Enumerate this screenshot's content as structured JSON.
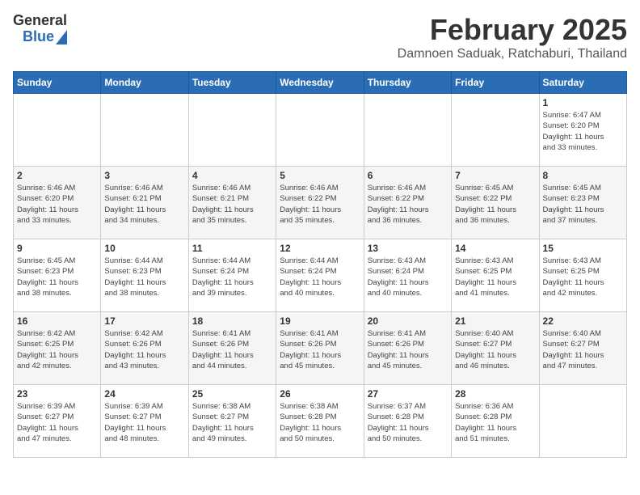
{
  "header": {
    "logo_general": "General",
    "logo_blue": "Blue",
    "month": "February 2025",
    "location": "Damnoen Saduak, Ratchaburi, Thailand"
  },
  "weekdays": [
    "Sunday",
    "Monday",
    "Tuesday",
    "Wednesday",
    "Thursday",
    "Friday",
    "Saturday"
  ],
  "weeks": [
    [
      {
        "day": "",
        "info": ""
      },
      {
        "day": "",
        "info": ""
      },
      {
        "day": "",
        "info": ""
      },
      {
        "day": "",
        "info": ""
      },
      {
        "day": "",
        "info": ""
      },
      {
        "day": "",
        "info": ""
      },
      {
        "day": "1",
        "info": "Sunrise: 6:47 AM\nSunset: 6:20 PM\nDaylight: 11 hours\nand 33 minutes."
      }
    ],
    [
      {
        "day": "2",
        "info": "Sunrise: 6:46 AM\nSunset: 6:20 PM\nDaylight: 11 hours\nand 33 minutes."
      },
      {
        "day": "3",
        "info": "Sunrise: 6:46 AM\nSunset: 6:21 PM\nDaylight: 11 hours\nand 34 minutes."
      },
      {
        "day": "4",
        "info": "Sunrise: 6:46 AM\nSunset: 6:21 PM\nDaylight: 11 hours\nand 35 minutes."
      },
      {
        "day": "5",
        "info": "Sunrise: 6:46 AM\nSunset: 6:22 PM\nDaylight: 11 hours\nand 35 minutes."
      },
      {
        "day": "6",
        "info": "Sunrise: 6:46 AM\nSunset: 6:22 PM\nDaylight: 11 hours\nand 36 minutes."
      },
      {
        "day": "7",
        "info": "Sunrise: 6:45 AM\nSunset: 6:22 PM\nDaylight: 11 hours\nand 36 minutes."
      },
      {
        "day": "8",
        "info": "Sunrise: 6:45 AM\nSunset: 6:23 PM\nDaylight: 11 hours\nand 37 minutes."
      }
    ],
    [
      {
        "day": "9",
        "info": "Sunrise: 6:45 AM\nSunset: 6:23 PM\nDaylight: 11 hours\nand 38 minutes."
      },
      {
        "day": "10",
        "info": "Sunrise: 6:44 AM\nSunset: 6:23 PM\nDaylight: 11 hours\nand 38 minutes."
      },
      {
        "day": "11",
        "info": "Sunrise: 6:44 AM\nSunset: 6:24 PM\nDaylight: 11 hours\nand 39 minutes."
      },
      {
        "day": "12",
        "info": "Sunrise: 6:44 AM\nSunset: 6:24 PM\nDaylight: 11 hours\nand 40 minutes."
      },
      {
        "day": "13",
        "info": "Sunrise: 6:43 AM\nSunset: 6:24 PM\nDaylight: 11 hours\nand 40 minutes."
      },
      {
        "day": "14",
        "info": "Sunrise: 6:43 AM\nSunset: 6:25 PM\nDaylight: 11 hours\nand 41 minutes."
      },
      {
        "day": "15",
        "info": "Sunrise: 6:43 AM\nSunset: 6:25 PM\nDaylight: 11 hours\nand 42 minutes."
      }
    ],
    [
      {
        "day": "16",
        "info": "Sunrise: 6:42 AM\nSunset: 6:25 PM\nDaylight: 11 hours\nand 42 minutes."
      },
      {
        "day": "17",
        "info": "Sunrise: 6:42 AM\nSunset: 6:26 PM\nDaylight: 11 hours\nand 43 minutes."
      },
      {
        "day": "18",
        "info": "Sunrise: 6:41 AM\nSunset: 6:26 PM\nDaylight: 11 hours\nand 44 minutes."
      },
      {
        "day": "19",
        "info": "Sunrise: 6:41 AM\nSunset: 6:26 PM\nDaylight: 11 hours\nand 45 minutes."
      },
      {
        "day": "20",
        "info": "Sunrise: 6:41 AM\nSunset: 6:26 PM\nDaylight: 11 hours\nand 45 minutes."
      },
      {
        "day": "21",
        "info": "Sunrise: 6:40 AM\nSunset: 6:27 PM\nDaylight: 11 hours\nand 46 minutes."
      },
      {
        "day": "22",
        "info": "Sunrise: 6:40 AM\nSunset: 6:27 PM\nDaylight: 11 hours\nand 47 minutes."
      }
    ],
    [
      {
        "day": "23",
        "info": "Sunrise: 6:39 AM\nSunset: 6:27 PM\nDaylight: 11 hours\nand 47 minutes."
      },
      {
        "day": "24",
        "info": "Sunrise: 6:39 AM\nSunset: 6:27 PM\nDaylight: 11 hours\nand 48 minutes."
      },
      {
        "day": "25",
        "info": "Sunrise: 6:38 AM\nSunset: 6:27 PM\nDaylight: 11 hours\nand 49 minutes."
      },
      {
        "day": "26",
        "info": "Sunrise: 6:38 AM\nSunset: 6:28 PM\nDaylight: 11 hours\nand 50 minutes."
      },
      {
        "day": "27",
        "info": "Sunrise: 6:37 AM\nSunset: 6:28 PM\nDaylight: 11 hours\nand 50 minutes."
      },
      {
        "day": "28",
        "info": "Sunrise: 6:36 AM\nSunset: 6:28 PM\nDaylight: 11 hours\nand 51 minutes."
      },
      {
        "day": "",
        "info": ""
      }
    ]
  ]
}
